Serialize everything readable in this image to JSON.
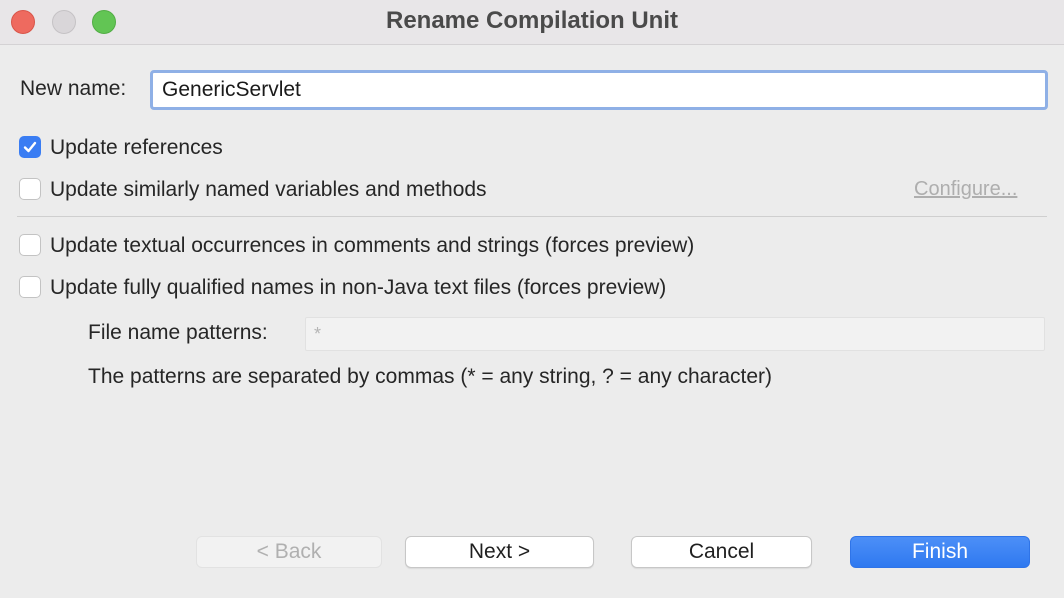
{
  "window": {
    "title": "Rename Compilation Unit"
  },
  "new_name": {
    "label": "New name:",
    "value": "GenericServlet"
  },
  "options": [
    {
      "label": "Update references",
      "checked": true
    },
    {
      "label": "Update similarly named variables and methods",
      "checked": false
    },
    {
      "label": "Update textual occurrences in comments and strings (forces preview)",
      "checked": false
    },
    {
      "label": "Update fully qualified names in non-Java text files (forces preview)",
      "checked": false
    }
  ],
  "configure_link": "Configure...",
  "file_patterns": {
    "label": "File name patterns:",
    "value": "*",
    "hint": "The patterns are separated by commas (* = any string, ? = any character)"
  },
  "buttons": {
    "back": "< Back",
    "next": "Next >",
    "cancel": "Cancel",
    "finish": "Finish"
  },
  "colors": {
    "accent": "#3a7df3",
    "close": "#ee6a5f",
    "maximize": "#62c554"
  }
}
